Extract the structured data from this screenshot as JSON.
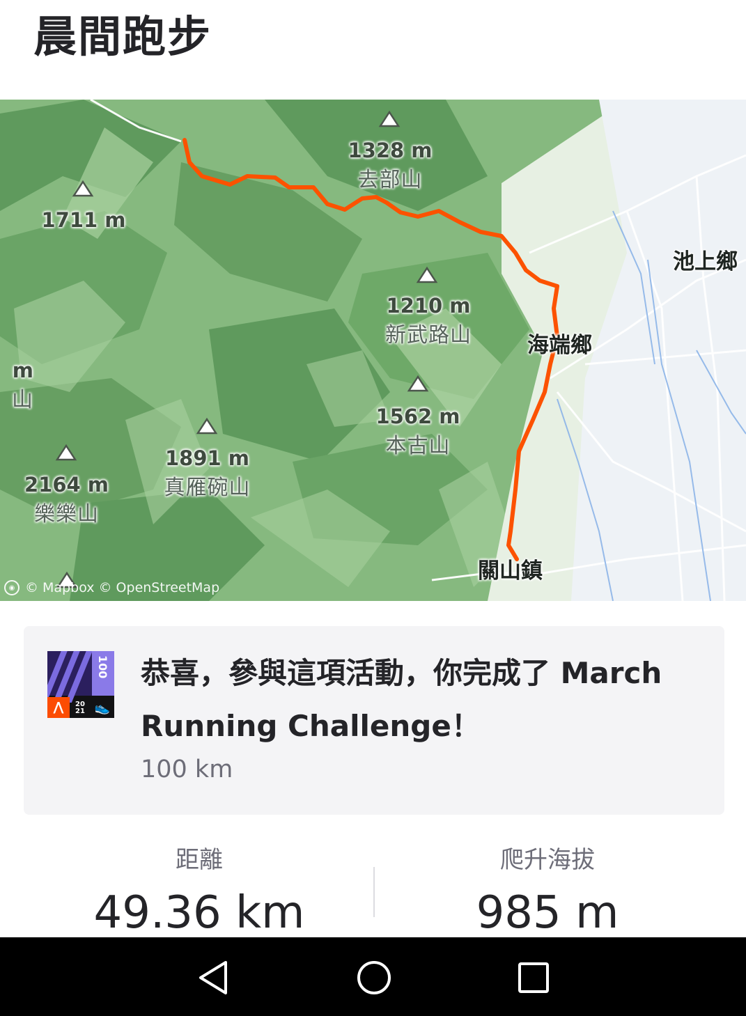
{
  "activity": {
    "title": "晨間跑步"
  },
  "map": {
    "peaks": [
      {
        "elevation": "1328 m",
        "name": "去部山"
      },
      {
        "elevation": "1711 m",
        "name": ""
      },
      {
        "elevation": "1210 m",
        "name": "新武路山"
      },
      {
        "elevation": "1562 m",
        "name": "本古山"
      },
      {
        "elevation": "1891 m",
        "name": "真雁碗山"
      },
      {
        "elevation": "2164 m",
        "name": "樂樂山"
      },
      {
        "elevation": "m",
        "name": "山"
      }
    ],
    "places": [
      "池上鄉",
      "海端鄉",
      "關山鎮"
    ],
    "attribution": "© Mapbox © OpenStreetMap",
    "route_color": "#fc5200"
  },
  "achievement": {
    "message": "恭喜，參與這項活動，你完成了 March Running Challenge！",
    "detail": "100 km",
    "badge": {
      "distance": "100",
      "unit": "KM",
      "year_top": "20",
      "year_bottom": "21"
    }
  },
  "stats": [
    {
      "label": "距離",
      "value": "49.36 km"
    },
    {
      "label": "爬升海拔",
      "value": "985 m"
    }
  ],
  "navigation": {
    "buttons": [
      "back-icon",
      "home-icon",
      "recents-icon"
    ]
  }
}
